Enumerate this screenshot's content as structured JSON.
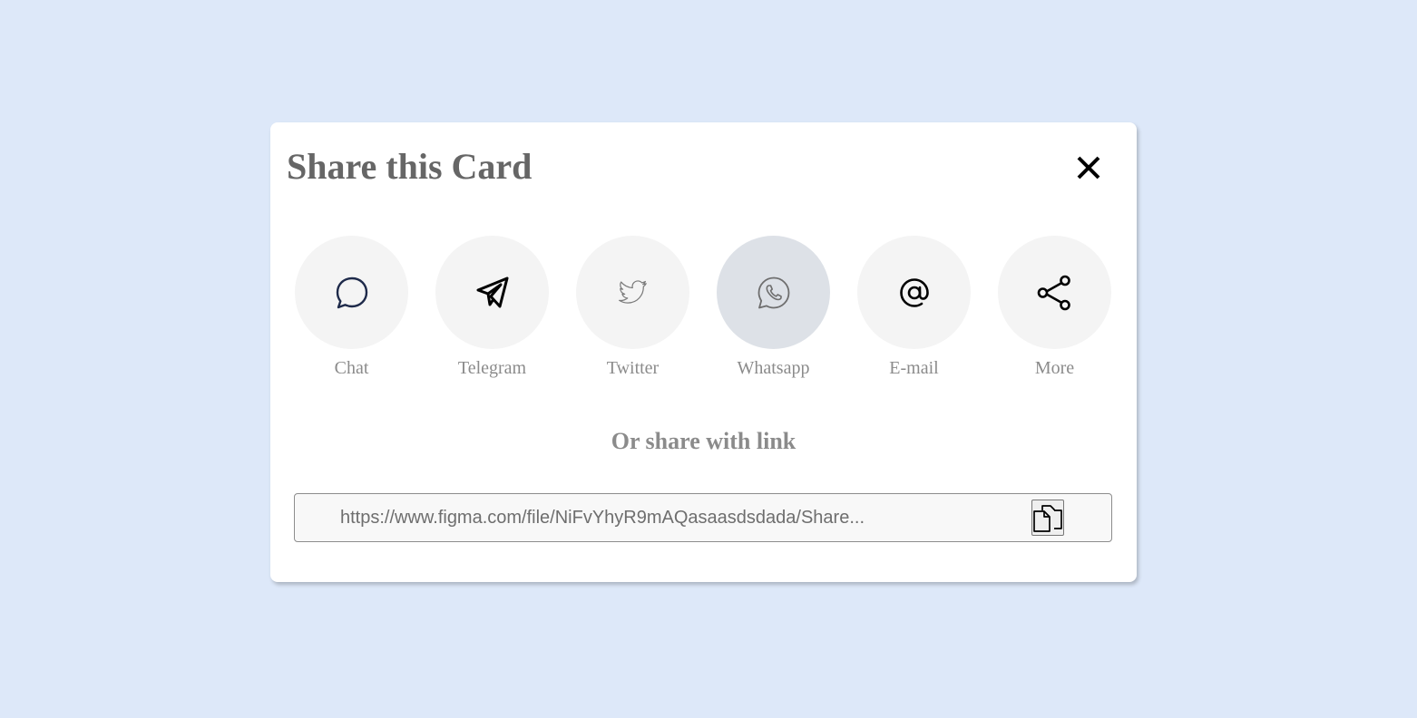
{
  "modal": {
    "title": "Share this Card",
    "close_icon": "close-icon"
  },
  "share_options": [
    {
      "label": "Chat",
      "icon": "chat-bubble-icon",
      "active": false
    },
    {
      "label": "Telegram",
      "icon": "telegram-icon",
      "active": false
    },
    {
      "label": "Twitter",
      "icon": "twitter-icon",
      "active": false
    },
    {
      "label": "Whatsapp",
      "icon": "whatsapp-icon",
      "active": true
    },
    {
      "label": "E-mail",
      "icon": "at-sign-icon",
      "active": false
    },
    {
      "label": "More",
      "icon": "share-icon",
      "active": false
    }
  ],
  "link_section": {
    "heading": "Or share with link",
    "url": "https://www.figma.com/file/NiFvYhyR9mAQasaasdsdada/Share...",
    "copy_icon": "copy-icon"
  },
  "colors": {
    "background": "#dde8f9",
    "modal": "#ffffff",
    "circle": "#f4f4f4",
    "circle_active": "#dde1e7",
    "title": "#666666",
    "label": "#8b8b8b"
  }
}
